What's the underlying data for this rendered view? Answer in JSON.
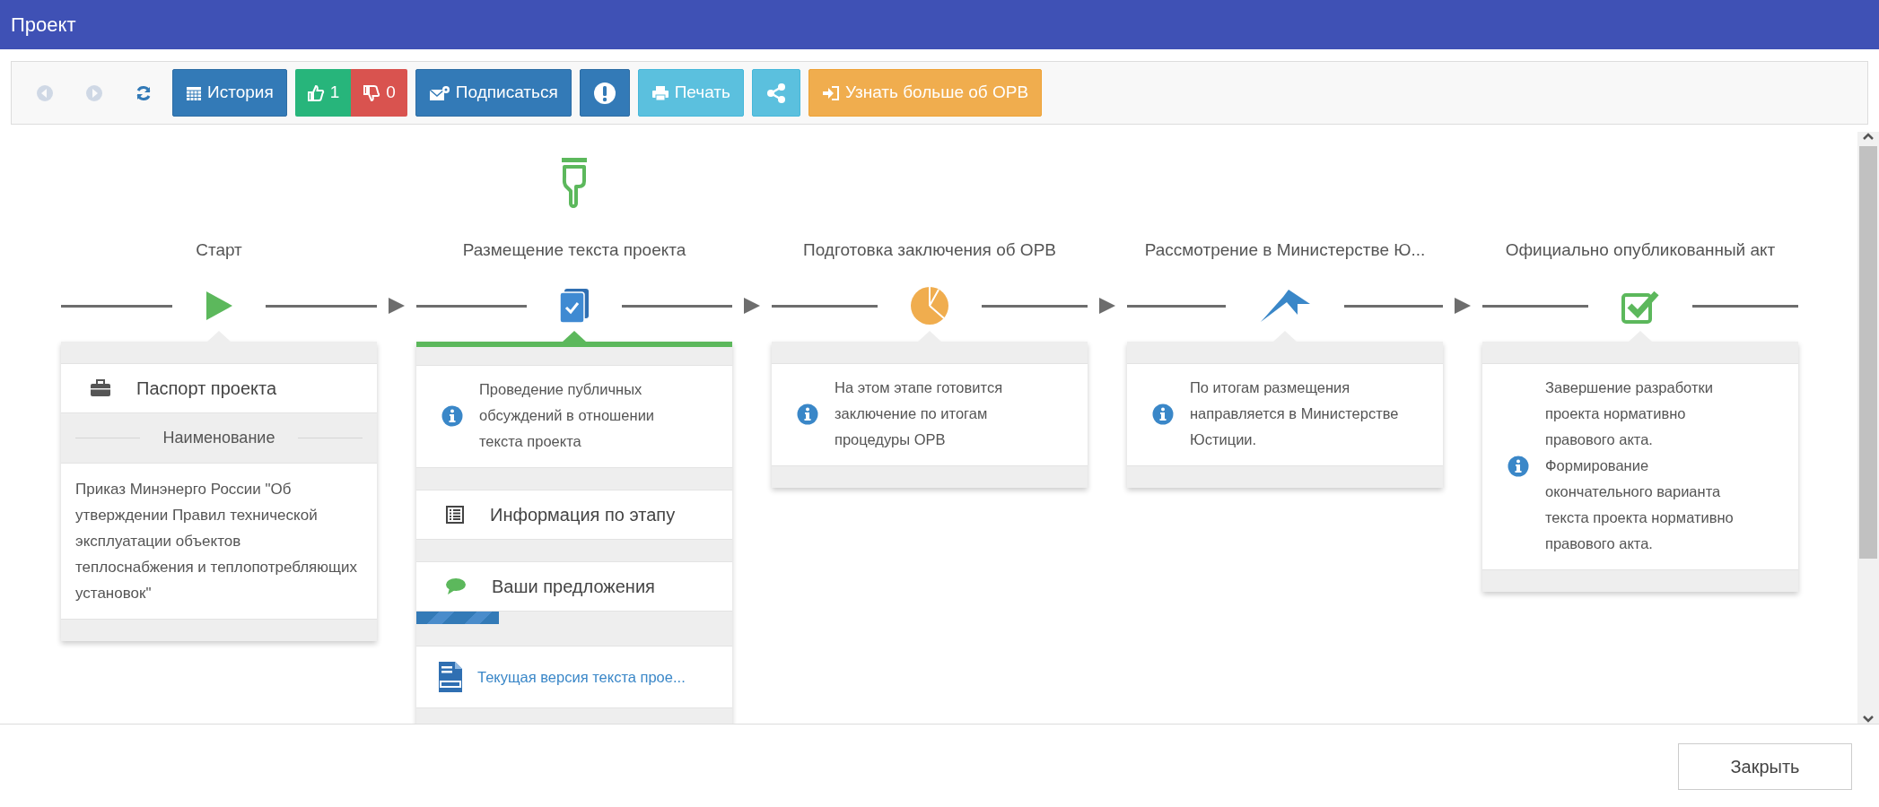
{
  "window": {
    "title": "Проект"
  },
  "toolbar": [
    {
      "kind": "back",
      "disabled": true
    },
    {
      "kind": "forward",
      "disabled": true
    },
    {
      "kind": "refresh",
      "disabled": false
    },
    {
      "kind": "history",
      "label": "История",
      "disabled": false
    },
    {
      "kind": "like",
      "label": "1",
      "disabled": false
    },
    {
      "kind": "dislike",
      "label": "0",
      "disabled": false
    },
    {
      "kind": "subscribe",
      "label": "Подписаться",
      "disabled": false
    },
    {
      "kind": "alert",
      "disabled": false
    },
    {
      "kind": "print",
      "label": "Печать",
      "disabled": false
    },
    {
      "kind": "share",
      "disabled": false
    },
    {
      "kind": "learn",
      "label": "Узнать больше об ОРВ",
      "disabled": false
    }
  ],
  "stages": [
    {
      "title": "Старт",
      "selected": false,
      "sections": [
        {
          "kind": "header",
          "text": "Паспорт проекта"
        },
        {
          "kind": "divider",
          "text": "Наименование"
        },
        {
          "kind": "text",
          "text": "Приказ Минэнерго России \"Об утверждении Правил технической эксплуатации объектов теплоснабжения и теплопотребляющих установок\""
        }
      ]
    },
    {
      "title": "Размещение текста проекта",
      "selected": true,
      "sections": [
        {
          "kind": "info",
          "text": "Проведение публичных обсуждений в отношении текста проекта"
        },
        {
          "kind": "stage-info",
          "text": "Информация по этапу"
        },
        {
          "kind": "proposals",
          "text": "Ваши предложения"
        },
        {
          "kind": "progress",
          "level": 0.26
        },
        {
          "kind": "link",
          "text": "Текущая версия текста прое..."
        }
      ]
    },
    {
      "title": "Подготовка заключения об ОРВ",
      "selected": false,
      "sections": [
        {
          "kind": "info",
          "text": "На этом этапе готовится заключение по итогам процедуры ОРВ"
        }
      ]
    },
    {
      "title": "Рассмотрение в Министерстве Ю...",
      "selected": false,
      "sections": [
        {
          "kind": "info",
          "text": "По итогам размещения направляется в Министерстве Юстиции."
        }
      ]
    },
    {
      "title": "Официально опубликованный акт",
      "selected": false,
      "sections": [
        {
          "kind": "info",
          "text": "Завершение разработки проекта нормативно правового акта. Формирование окончательного варианта текста проекта нормативно правового акта."
        }
      ]
    }
  ],
  "footer": {
    "close_button": "Закрыть"
  }
}
